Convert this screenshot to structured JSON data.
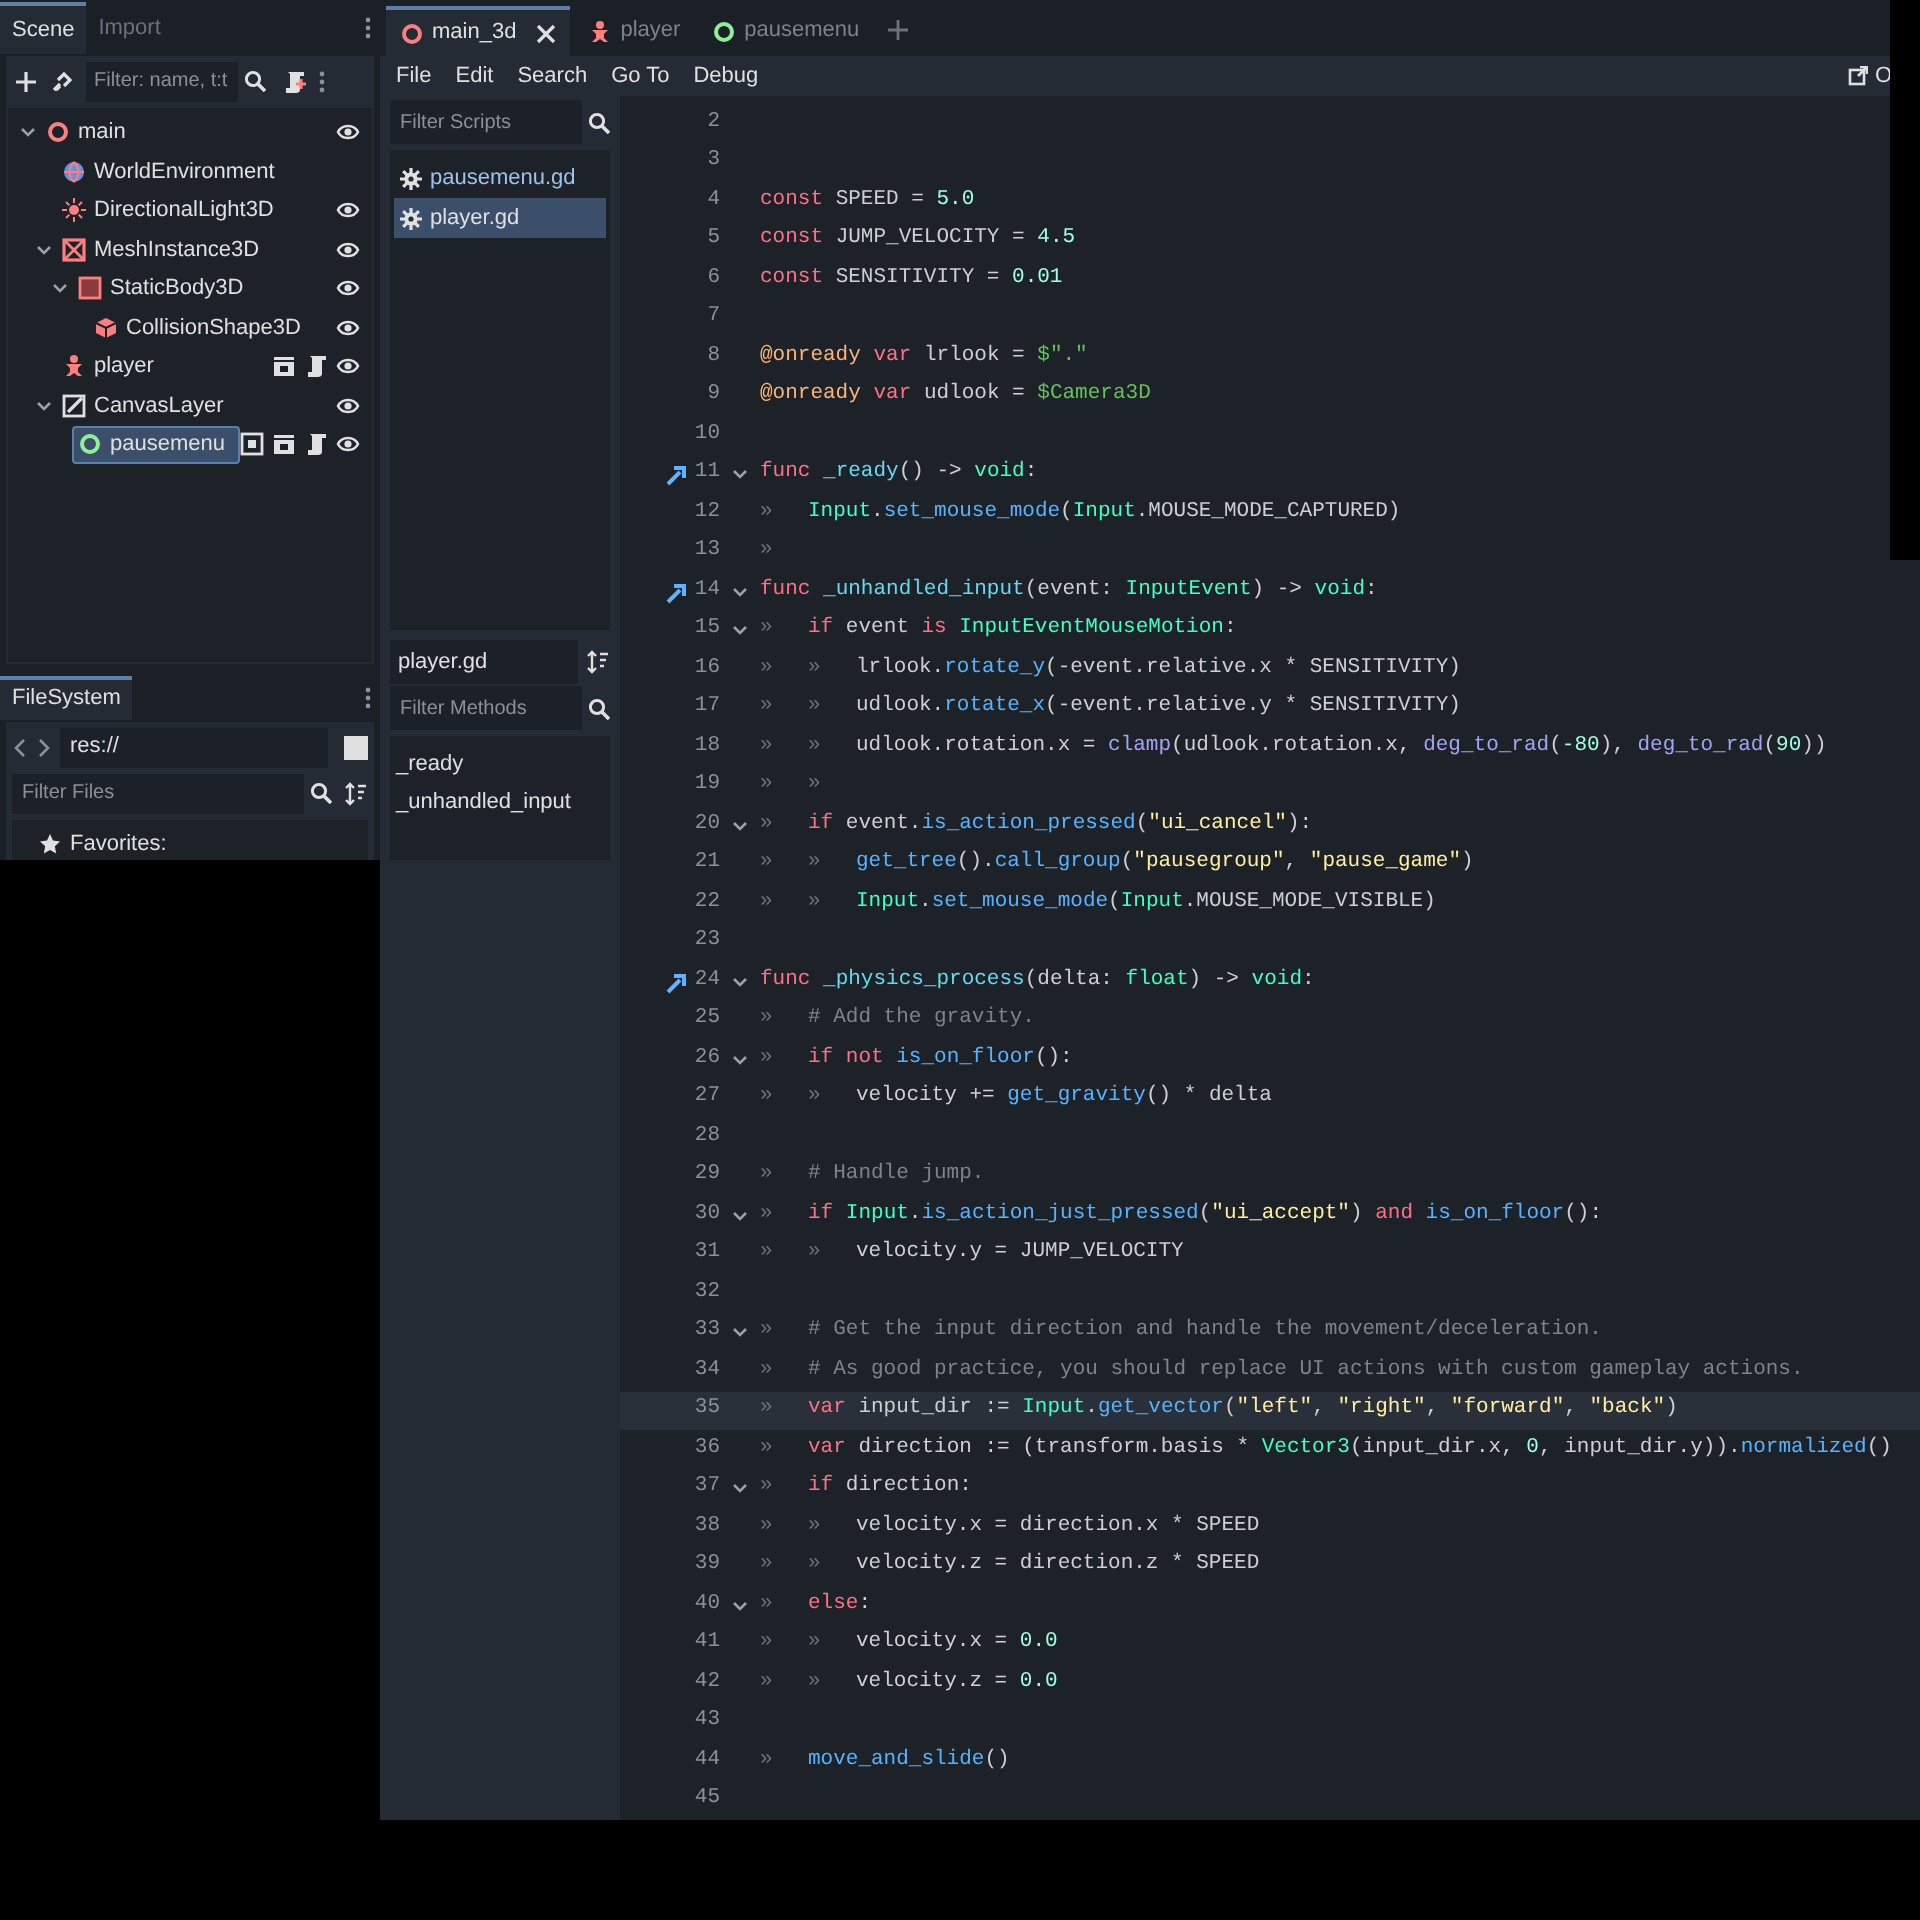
{
  "editor_tabs": [
    {
      "label": "main_3d",
      "kind": "node3d",
      "selected": true,
      "closable": true
    },
    {
      "label": "player",
      "kind": "player",
      "selected": false,
      "closable": false
    },
    {
      "label": "pausemenu",
      "kind": "control",
      "selected": false,
      "closable": false
    }
  ],
  "menu": [
    "File",
    "Edit",
    "Search",
    "Go To",
    "Debug"
  ],
  "menu_right_button": "O",
  "scene_dock": {
    "tabs": [
      {
        "label": "Scene",
        "selected": true
      },
      {
        "label": "Import",
        "selected": false
      }
    ],
    "filter": {
      "placeholder": "Filter: name, t:t"
    },
    "tree": [
      {
        "label": "main",
        "kind": "node3d",
        "expanded": true,
        "visible": true,
        "selected": false,
        "children": [
          {
            "label": "WorldEnvironment",
            "kind": "environment",
            "selected": false
          },
          {
            "label": "DirectionalLight3D",
            "kind": "light",
            "visible": true,
            "selected": false
          },
          {
            "label": "MeshInstance3D",
            "kind": "mesh",
            "expanded": true,
            "visible": true,
            "selected": false,
            "children": [
              {
                "label": "StaticBody3D",
                "kind": "body",
                "expanded": true,
                "visible": true,
                "selected": false,
                "children": [
                  {
                    "label": "CollisionShape3D",
                    "kind": "shape",
                    "visible": true,
                    "selected": false
                  }
                ]
              }
            ]
          },
          {
            "label": "player",
            "kind": "player",
            "instanced": true,
            "scripted": true,
            "visible": true,
            "selected": false
          },
          {
            "label": "CanvasLayer",
            "kind": "canvas",
            "expanded": true,
            "visible": true,
            "selected": false,
            "children": [
              {
                "label": "pausemenu",
                "kind": "control",
                "grouped": true,
                "instanced": true,
                "scripted": true,
                "visible": true,
                "selected": true
              }
            ]
          }
        ]
      }
    ]
  },
  "filesystem_dock": {
    "tab": "FileSystem",
    "path": "res://",
    "filter": {
      "placeholder": "Filter Files"
    },
    "items": [
      {
        "label": "Favorites:"
      }
    ]
  },
  "scripts": {
    "filter": {
      "placeholder": "Filter Scripts"
    },
    "items": [
      {
        "label": "pausemenu.gd",
        "selected": false
      },
      {
        "label": "player.gd",
        "selected": true
      }
    ],
    "current_file": "player.gd",
    "methods_filter": {
      "placeholder": "Filter Methods"
    },
    "methods": [
      "_ready",
      "_unhandled_input"
    ]
  },
  "code": {
    "lines": [
      {
        "number": "2",
        "fold": false,
        "override": false,
        "current": false
      },
      {
        "number": "3",
        "fold": false,
        "override": false,
        "current": false
      },
      {
        "number": "4",
        "fold": false,
        "override": false,
        "current": false,
        "segments": [
          {
            "kind": "keyword",
            "text": "const"
          },
          {
            "kind": "plain",
            "text": " SPEED = "
          },
          {
            "kind": "number",
            "text": "5.0"
          }
        ]
      },
      {
        "number": "5",
        "fold": false,
        "override": false,
        "current": false,
        "segments": [
          {
            "kind": "keyword",
            "text": "const"
          },
          {
            "kind": "plain",
            "text": " JUMP_VELOCITY = "
          },
          {
            "kind": "number",
            "text": "4.5"
          }
        ]
      },
      {
        "number": "6",
        "fold": false,
        "override": false,
        "current": false,
        "segments": [
          {
            "kind": "keyword",
            "text": "const"
          },
          {
            "kind": "plain",
            "text": " SENSITIVITY = "
          },
          {
            "kind": "number",
            "text": "0.01"
          }
        ]
      },
      {
        "number": "7",
        "fold": false,
        "override": false,
        "current": false
      },
      {
        "number": "8",
        "fold": false,
        "override": false,
        "current": false,
        "segments": [
          {
            "kind": "annotation",
            "text": "@onready"
          },
          {
            "kind": "keyword",
            "text": " var"
          },
          {
            "kind": "plain",
            "text": " lrlook = "
          },
          {
            "kind": "nodepath",
            "text": "$\".\""
          }
        ]
      },
      {
        "number": "9",
        "fold": false,
        "override": false,
        "current": false,
        "segments": [
          {
            "kind": "annotation",
            "text": "@onready"
          },
          {
            "kind": "keyword",
            "text": " var"
          },
          {
            "kind": "plain",
            "text": " udlook = "
          },
          {
            "kind": "nodepath",
            "text": "$Camera3D"
          }
        ]
      },
      {
        "number": "10",
        "fold": false,
        "override": false,
        "current": false
      },
      {
        "number": "11",
        "fold": true,
        "override": true,
        "current": false,
        "segments": [
          {
            "kind": "keyword",
            "text": "func"
          },
          {
            "kind": "funcname",
            "text": " _ready"
          },
          {
            "kind": "plain",
            "text": "() -> "
          },
          {
            "kind": "type",
            "text": "void"
          },
          {
            "kind": "plain",
            "text": ":"
          }
        ]
      },
      {
        "number": "12",
        "fold": false,
        "override": false,
        "current": false,
        "segments": [
          {
            "kind": "indent",
            "text": "»"
          },
          {
            "kind": "type",
            "text": "Input"
          },
          {
            "kind": "plain",
            "text": "."
          },
          {
            "kind": "call",
            "text": "set_mouse_mode"
          },
          {
            "kind": "plain",
            "text": "("
          },
          {
            "kind": "type",
            "text": "Input"
          },
          {
            "kind": "plain",
            "text": ".MOUSE_MODE_CAPTURED)"
          }
        ]
      },
      {
        "number": "13",
        "fold": false,
        "override": false,
        "current": false,
        "segments": [
          {
            "kind": "indent",
            "text": "»"
          }
        ]
      },
      {
        "number": "14",
        "fold": true,
        "override": true,
        "current": false,
        "segments": [
          {
            "kind": "keyword",
            "text": "func"
          },
          {
            "kind": "funcname",
            "text": " _unhandled_input"
          },
          {
            "kind": "plain",
            "text": "(event: "
          },
          {
            "kind": "type",
            "text": "InputEvent"
          },
          {
            "kind": "plain",
            "text": ") -> "
          },
          {
            "kind": "type",
            "text": "void"
          },
          {
            "kind": "plain",
            "text": ":"
          }
        ]
      },
      {
        "number": "15",
        "fold": true,
        "override": false,
        "current": false,
        "segments": [
          {
            "kind": "indent",
            "text": "»"
          },
          {
            "kind": "keyword",
            "text": "if"
          },
          {
            "kind": "plain",
            "text": " event "
          },
          {
            "kind": "keyword",
            "text": "is"
          },
          {
            "kind": "type",
            "text": " InputEventMouseMotion"
          },
          {
            "kind": "plain",
            "text": ":"
          }
        ]
      },
      {
        "number": "16",
        "fold": false,
        "override": false,
        "current": false,
        "segments": [
          {
            "kind": "indent",
            "text": "»"
          },
          {
            "kind": "indent",
            "text": "»"
          },
          {
            "kind": "plain",
            "text": "lrlook."
          },
          {
            "kind": "call",
            "text": "rotate_y"
          },
          {
            "kind": "plain",
            "text": "(-event.relative.x * SENSITIVITY)"
          }
        ]
      },
      {
        "number": "17",
        "fold": false,
        "override": false,
        "current": false,
        "segments": [
          {
            "kind": "indent",
            "text": "»"
          },
          {
            "kind": "indent",
            "text": "»"
          },
          {
            "kind": "plain",
            "text": "udlook."
          },
          {
            "kind": "call",
            "text": "rotate_x"
          },
          {
            "kind": "plain",
            "text": "(-event.relative.y * SENSITIVITY)"
          }
        ]
      },
      {
        "number": "18",
        "fold": false,
        "override": false,
        "current": false,
        "segments": [
          {
            "kind": "indent",
            "text": "»"
          },
          {
            "kind": "indent",
            "text": "»"
          },
          {
            "kind": "plain",
            "text": "udlook.rotation.x = "
          },
          {
            "kind": "global",
            "text": "clamp"
          },
          {
            "kind": "plain",
            "text": "(udlook.rotation.x, "
          },
          {
            "kind": "global",
            "text": "deg_to_rad"
          },
          {
            "kind": "plain",
            "text": "("
          },
          {
            "kind": "number",
            "text": "-80"
          },
          {
            "kind": "plain",
            "text": "), "
          },
          {
            "kind": "global",
            "text": "deg_to_rad"
          },
          {
            "kind": "plain",
            "text": "("
          },
          {
            "kind": "number",
            "text": "90"
          },
          {
            "kind": "plain",
            "text": "))"
          }
        ]
      },
      {
        "number": "19",
        "fold": false,
        "override": false,
        "current": false,
        "segments": [
          {
            "kind": "indent",
            "text": "»"
          },
          {
            "kind": "indent",
            "text": "»"
          }
        ]
      },
      {
        "number": "20",
        "fold": true,
        "override": false,
        "current": false,
        "segments": [
          {
            "kind": "indent",
            "text": "»"
          },
          {
            "kind": "keyword",
            "text": "if"
          },
          {
            "kind": "plain",
            "text": " event."
          },
          {
            "kind": "call",
            "text": "is_action_pressed"
          },
          {
            "kind": "plain",
            "text": "("
          },
          {
            "kind": "string",
            "text": "\"ui_cancel\""
          },
          {
            "kind": "plain",
            "text": "):"
          }
        ]
      },
      {
        "number": "21",
        "fold": false,
        "override": false,
        "current": false,
        "segments": [
          {
            "kind": "indent",
            "text": "»"
          },
          {
            "kind": "indent",
            "text": "»"
          },
          {
            "kind": "call",
            "text": "get_tree"
          },
          {
            "kind": "plain",
            "text": "()."
          },
          {
            "kind": "call",
            "text": "call_group"
          },
          {
            "kind": "plain",
            "text": "("
          },
          {
            "kind": "string",
            "text": "\"pausegroup\""
          },
          {
            "kind": "plain",
            "text": ", "
          },
          {
            "kind": "string",
            "text": "\"pause_game\""
          },
          {
            "kind": "plain",
            "text": ")"
          }
        ]
      },
      {
        "number": "22",
        "fold": false,
        "override": false,
        "current": false,
        "segments": [
          {
            "kind": "indent",
            "text": "»"
          },
          {
            "kind": "indent",
            "text": "»"
          },
          {
            "kind": "type",
            "text": "Input"
          },
          {
            "kind": "plain",
            "text": "."
          },
          {
            "kind": "call",
            "text": "set_mouse_mode"
          },
          {
            "kind": "plain",
            "text": "("
          },
          {
            "kind": "type",
            "text": "Input"
          },
          {
            "kind": "plain",
            "text": ".MOUSE_MODE_VISIBLE)"
          }
        ]
      },
      {
        "number": "23",
        "fold": false,
        "override": false,
        "current": false
      },
      {
        "number": "24",
        "fold": true,
        "override": true,
        "current": false,
        "segments": [
          {
            "kind": "keyword",
            "text": "func"
          },
          {
            "kind": "funcname",
            "text": " _physics_process"
          },
          {
            "kind": "plain",
            "text": "(delta: "
          },
          {
            "kind": "type",
            "text": "float"
          },
          {
            "kind": "plain",
            "text": ") -> "
          },
          {
            "kind": "type",
            "text": "void"
          },
          {
            "kind": "plain",
            "text": ":"
          }
        ]
      },
      {
        "number": "25",
        "fold": false,
        "override": false,
        "current": false,
        "segments": [
          {
            "kind": "indent",
            "text": "»"
          },
          {
            "kind": "comment",
            "text": "# Add the gravity."
          }
        ]
      },
      {
        "number": "26",
        "fold": true,
        "override": false,
        "current": false,
        "segments": [
          {
            "kind": "indent",
            "text": "»"
          },
          {
            "kind": "keyword",
            "text": "if not"
          },
          {
            "kind": "call",
            "text": " is_on_floor"
          },
          {
            "kind": "plain",
            "text": "():"
          }
        ]
      },
      {
        "number": "27",
        "fold": false,
        "override": false,
        "current": false,
        "segments": [
          {
            "kind": "indent",
            "text": "»"
          },
          {
            "kind": "indent",
            "text": "»"
          },
          {
            "kind": "plain",
            "text": "velocity += "
          },
          {
            "kind": "call",
            "text": "get_gravity"
          },
          {
            "kind": "plain",
            "text": "() * delta"
          }
        ]
      },
      {
        "number": "28",
        "fold": false,
        "override": false,
        "current": false
      },
      {
        "number": "29",
        "fold": false,
        "override": false,
        "current": false,
        "segments": [
          {
            "kind": "indent",
            "text": "»"
          },
          {
            "kind": "comment",
            "text": "# Handle jump."
          }
        ]
      },
      {
        "number": "30",
        "fold": true,
        "override": false,
        "current": false,
        "segments": [
          {
            "kind": "indent",
            "text": "»"
          },
          {
            "kind": "keyword",
            "text": "if"
          },
          {
            "kind": "type",
            "text": " Input"
          },
          {
            "kind": "plain",
            "text": "."
          },
          {
            "kind": "call",
            "text": "is_action_just_pressed"
          },
          {
            "kind": "plain",
            "text": "("
          },
          {
            "kind": "string",
            "text": "\"ui_accept\""
          },
          {
            "kind": "plain",
            "text": ") "
          },
          {
            "kind": "keyword",
            "text": "and"
          },
          {
            "kind": "call",
            "text": " is_on_floor"
          },
          {
            "kind": "plain",
            "text": "():"
          }
        ]
      },
      {
        "number": "31",
        "fold": false,
        "override": false,
        "current": false,
        "segments": [
          {
            "kind": "indent",
            "text": "»"
          },
          {
            "kind": "indent",
            "text": "»"
          },
          {
            "kind": "plain",
            "text": "velocity.y = JUMP_VELOCITY"
          }
        ]
      },
      {
        "number": "32",
        "fold": false,
        "override": false,
        "current": false
      },
      {
        "number": "33",
        "fold": true,
        "override": false,
        "current": false,
        "segments": [
          {
            "kind": "indent",
            "text": "»"
          },
          {
            "kind": "comment",
            "text": "# Get the input direction and handle the movement/deceleration."
          }
        ]
      },
      {
        "number": "34",
        "fold": false,
        "override": false,
        "current": false,
        "segments": [
          {
            "kind": "indent",
            "text": "»"
          },
          {
            "kind": "comment",
            "text": "# As good practice, you should replace UI actions with custom gameplay actions."
          }
        ]
      },
      {
        "number": "35",
        "fold": false,
        "override": false,
        "current": true,
        "segments": [
          {
            "kind": "indent",
            "text": "»"
          },
          {
            "kind": "keyword",
            "text": "var"
          },
          {
            "kind": "plain",
            "text": " input_dir := "
          },
          {
            "kind": "type",
            "text": "Input"
          },
          {
            "kind": "plain",
            "text": "."
          },
          {
            "kind": "call",
            "text": "get_vector"
          },
          {
            "kind": "plain",
            "text": "("
          },
          {
            "kind": "string",
            "text": "\"left\""
          },
          {
            "kind": "plain",
            "text": ", "
          },
          {
            "kind": "string",
            "text": "\"right\""
          },
          {
            "kind": "plain",
            "text": ", "
          },
          {
            "kind": "string",
            "text": "\"forward\""
          },
          {
            "kind": "plain",
            "text": ", "
          },
          {
            "kind": "string",
            "text": "\"back\""
          },
          {
            "kind": "plain",
            "text": ")"
          }
        ]
      },
      {
        "number": "36",
        "fold": false,
        "override": false,
        "current": false,
        "segments": [
          {
            "kind": "indent",
            "text": "»"
          },
          {
            "kind": "keyword",
            "text": "var"
          },
          {
            "kind": "plain",
            "text": " direction := (transform.basis * "
          },
          {
            "kind": "type",
            "text": "Vector3"
          },
          {
            "kind": "plain",
            "text": "(input_dir.x, "
          },
          {
            "kind": "number",
            "text": "0"
          },
          {
            "kind": "plain",
            "text": ", input_dir.y))."
          },
          {
            "kind": "call",
            "text": "normalized"
          },
          {
            "kind": "plain",
            "text": "()"
          }
        ]
      },
      {
        "number": "37",
        "fold": true,
        "override": false,
        "current": false,
        "segments": [
          {
            "kind": "indent",
            "text": "»"
          },
          {
            "kind": "keyword",
            "text": "if"
          },
          {
            "kind": "plain",
            "text": " direction:"
          }
        ]
      },
      {
        "number": "38",
        "fold": false,
        "override": false,
        "current": false,
        "segments": [
          {
            "kind": "indent",
            "text": "»"
          },
          {
            "kind": "indent",
            "text": "»"
          },
          {
            "kind": "plain",
            "text": "velocity.x = direction.x * SPEED"
          }
        ]
      },
      {
        "number": "39",
        "fold": false,
        "override": false,
        "current": false,
        "segments": [
          {
            "kind": "indent",
            "text": "»"
          },
          {
            "kind": "indent",
            "text": "»"
          },
          {
            "kind": "plain",
            "text": "velocity.z = direction.z * SPEED"
          }
        ]
      },
      {
        "number": "40",
        "fold": true,
        "override": false,
        "current": false,
        "segments": [
          {
            "kind": "indent",
            "text": "»"
          },
          {
            "kind": "keyword",
            "text": "else"
          },
          {
            "kind": "plain",
            "text": ":"
          }
        ]
      },
      {
        "number": "41",
        "fold": false,
        "override": false,
        "current": false,
        "segments": [
          {
            "kind": "indent",
            "text": "»"
          },
          {
            "kind": "indent",
            "text": "»"
          },
          {
            "kind": "plain",
            "text": "velocity.x = "
          },
          {
            "kind": "number",
            "text": "0.0"
          }
        ]
      },
      {
        "number": "42",
        "fold": false,
        "override": false,
        "current": false,
        "segments": [
          {
            "kind": "indent",
            "text": "»"
          },
          {
            "kind": "indent",
            "text": "»"
          },
          {
            "kind": "plain",
            "text": "velocity.z = "
          },
          {
            "kind": "number",
            "text": "0.0"
          }
        ]
      },
      {
        "number": "43",
        "fold": false,
        "override": false,
        "current": false
      },
      {
        "number": "44",
        "fold": false,
        "override": false,
        "current": false,
        "segments": [
          {
            "kind": "indent",
            "text": "»"
          },
          {
            "kind": "call",
            "text": "move_and_slide"
          },
          {
            "kind": "plain",
            "text": "()"
          }
        ]
      },
      {
        "number": "45",
        "fold": false,
        "override": false,
        "current": false
      }
    ]
  }
}
